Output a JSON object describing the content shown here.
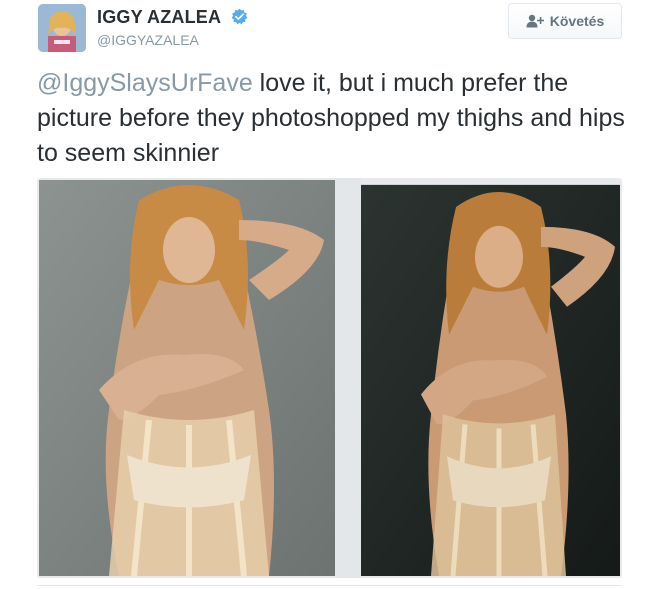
{
  "user": {
    "display_name": "IGGY AZALEA",
    "screen_name": "@IGGYAZALEA",
    "verified": true,
    "avatar_icon": "profile-photo"
  },
  "follow_button": {
    "label": "Követés",
    "icon": "add-user-icon"
  },
  "tweet": {
    "mention": "@IggySlaysUrFave",
    "text": " love it, but i much prefer the picture before they photoshopped my thighs and hips to seem skinnier"
  },
  "media": {
    "photos": [
      {
        "description_icon": "photo-original"
      },
      {
        "description_icon": "photo-edited"
      }
    ]
  },
  "colors": {
    "name": "#292f33",
    "muted": "#8899a6",
    "verified": "#55acee",
    "button_text": "#66757f"
  }
}
